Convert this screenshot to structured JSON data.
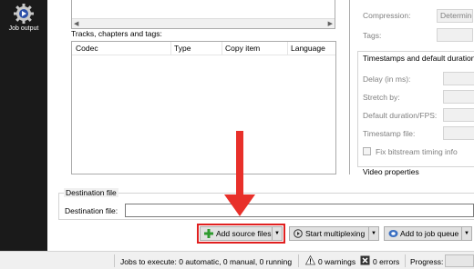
{
  "sidebar": {
    "job_output_label": "Job output"
  },
  "tracks": {
    "section_label": "Tracks, chapters and tags:",
    "columns": [
      "Codec",
      "Type",
      "Copy item",
      "Language"
    ]
  },
  "properties": {
    "compression_label": "Compression:",
    "compression_value": "Determine",
    "tags_label": "Tags:",
    "timestamps_group": "Timestamps and default duration",
    "delay_label": "Delay (in ms):",
    "stretch_label": "Stretch by:",
    "default_duration_label": "Default duration/FPS:",
    "timestamp_file_label": "Timestamp file:",
    "fix_bitstream_label": "Fix bitstream timing info",
    "video_properties_group": "Video properties"
  },
  "destination": {
    "group_label": "Destination file",
    "field_label": "Destination file:",
    "value": ""
  },
  "actions": {
    "add_source_files": "Add source files",
    "start_multiplexing": "Start multiplexing",
    "add_to_job_queue": "Add to job queue"
  },
  "status": {
    "jobs_to_execute": "Jobs to execute:  0 automatic, 0 manual, 0 running",
    "warnings": "0 warnings",
    "errors": "0 errors",
    "progress_label": "Progress:",
    "progress_value": 0
  },
  "colors": {
    "annotation_red": "#e8302a",
    "sidebar_bg": "#1a1a1a"
  }
}
